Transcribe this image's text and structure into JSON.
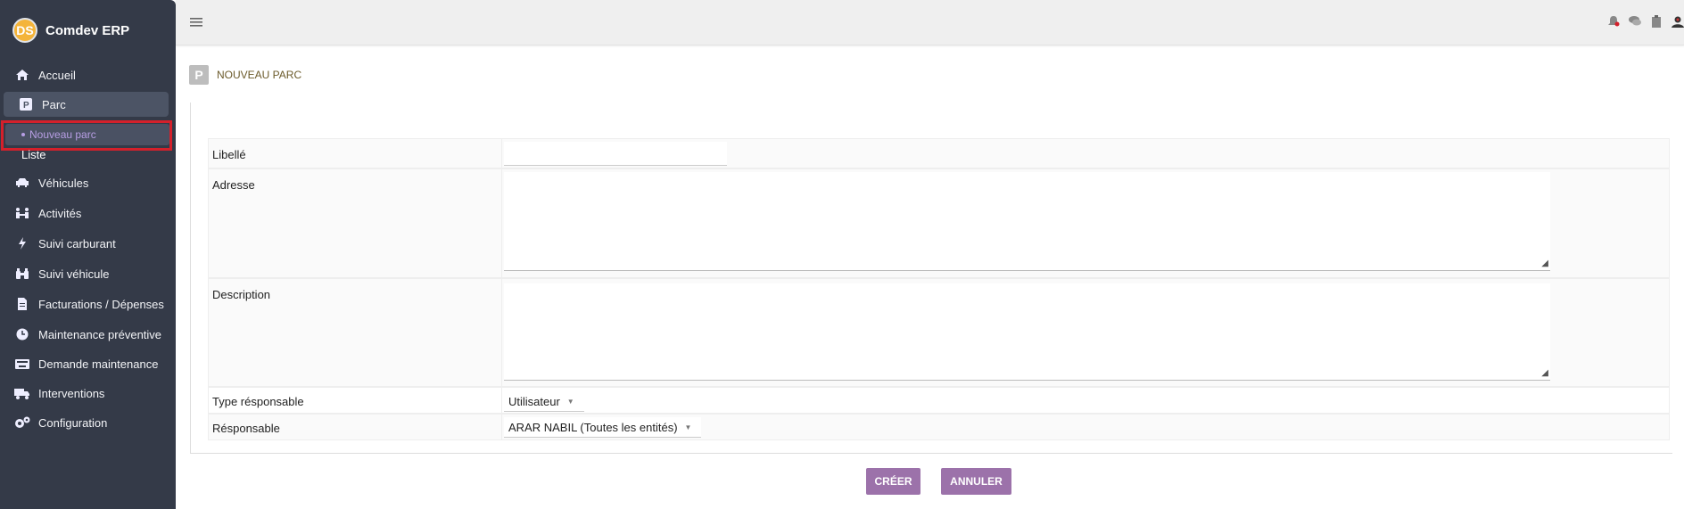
{
  "app": {
    "name": "Comdev ERP",
    "logo_text": "DS"
  },
  "sidebar": {
    "items": [
      {
        "label": "Accueil",
        "icon": "home-icon"
      },
      {
        "label": "Parc",
        "icon": "parking-icon"
      },
      {
        "label": "Véhicules",
        "icon": "car-icon"
      },
      {
        "label": "Activités",
        "icon": "people-icon"
      },
      {
        "label": "Suivi carburant",
        "icon": "bolt-icon"
      },
      {
        "label": "Suivi véhicule",
        "icon": "binoculars-icon"
      },
      {
        "label": "Facturations / Dépenses",
        "icon": "invoice-icon"
      },
      {
        "label": "Maintenance préventive",
        "icon": "clock-icon"
      },
      {
        "label": "Demande maintenance",
        "icon": "keyboard-icon"
      },
      {
        "label": "Interventions",
        "icon": "truck-icon"
      },
      {
        "label": "Configuration",
        "icon": "gears-icon"
      }
    ],
    "sub_items": [
      {
        "label": "Nouveau parc"
      },
      {
        "label": "Liste"
      }
    ]
  },
  "topbar": {
    "menu_icon": "hamburger-icon",
    "icons": [
      "alerts-icon",
      "messages-icon",
      "clipboard-icon",
      "user-avatar-icon"
    ]
  },
  "page": {
    "title": "NOUVEAU PARC",
    "icon_text": "P"
  },
  "form": {
    "libelle_label": "Libellé",
    "libelle_value": "",
    "adresse_label": "Adresse",
    "adresse_value": "",
    "description_label": "Description",
    "description_value": "",
    "type_label": "Type résponsable",
    "type_value": "Utilisateur",
    "responsable_label": "Résponsable",
    "responsable_value": "ARAR NABIL (Toutes les entités)"
  },
  "actions": {
    "create_label": "CRÉER",
    "cancel_label": "ANNULER"
  },
  "colors": {
    "sidebar_bg": "#343a48",
    "accent": "#9c72aa",
    "highlight_border": "#d4202b"
  }
}
